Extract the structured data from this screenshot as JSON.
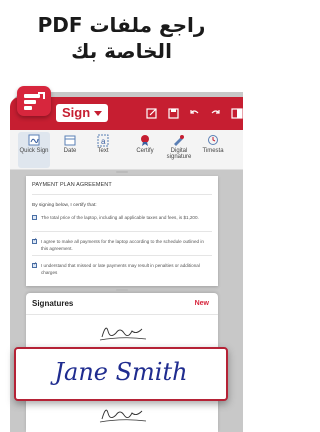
{
  "headline": {
    "line1": "راجع ملفات PDF",
    "line2": "الخاصة بك"
  },
  "app": {
    "brand_color": "#c61e31",
    "sign_label": "Sign"
  },
  "toolbar": {
    "tools": [
      {
        "label": "Quick Sign",
        "label_line2": "Sign",
        "icon": "quick-sign-icon"
      },
      {
        "label": "Date",
        "icon": "calendar-icon"
      },
      {
        "label": "Text",
        "icon": "text-icon"
      },
      {
        "label": "Certify",
        "icon": "certify-icon"
      },
      {
        "label": "Digital signature",
        "icon": "digital-signature-icon"
      },
      {
        "label": "Timesta",
        "icon": "timestamp-icon"
      }
    ]
  },
  "document": {
    "title": "PAYMENT PLAN AGREEMENT",
    "intro": "By signing below, I certify that:",
    "items": [
      {
        "text": "The total price of the laptop, including all applicable taxes and fees, is $1,200.",
        "checked": false
      },
      {
        "text": "I agree to make all payments for the laptop according to the schedule outlined in this agreement.",
        "checked": true
      },
      {
        "text": "I understand that missed or late payments may result in penalties or additional charges",
        "checked": true
      }
    ]
  },
  "signatures": {
    "header": "Signatures",
    "new_label": "New",
    "featured_name": "Jane Smith"
  }
}
